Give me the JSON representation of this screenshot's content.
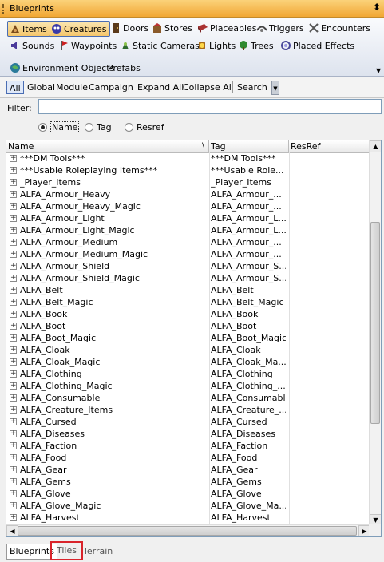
{
  "panel": {
    "title": "Blueprints",
    "pin_glyph": "⬍"
  },
  "toolbar": {
    "row1": [
      {
        "label": "Items",
        "icon": "items-icon",
        "active": true
      },
      {
        "label": "Creatures",
        "icon": "creatures-icon",
        "active": true
      },
      {
        "label": "Doors",
        "icon": "doors-icon"
      },
      {
        "label": "Stores",
        "icon": "stores-icon"
      },
      {
        "label": "Placeables",
        "icon": "placeables-icon"
      },
      {
        "label": "Triggers",
        "icon": "triggers-icon"
      },
      {
        "label": "Encounters",
        "icon": "encounters-icon"
      }
    ],
    "row2": [
      {
        "label": "Sounds",
        "icon": "sounds-icon"
      },
      {
        "label": "Waypoints",
        "icon": "waypoints-icon"
      },
      {
        "label": "Static Cameras",
        "icon": "cameras-icon"
      },
      {
        "label": "Lights",
        "icon": "lights-icon"
      },
      {
        "label": "Trees",
        "icon": "trees-icon"
      },
      {
        "label": "Placed Effects",
        "icon": "effects-icon"
      }
    ],
    "row3": [
      {
        "label": "Environment Objects",
        "icon": "environment-icon"
      },
      {
        "label": "Prefabs"
      }
    ]
  },
  "filter_bar": {
    "buttons": [
      "All",
      "Global",
      "Module",
      "Campaign",
      "Expand All",
      "Collapse All",
      "Search"
    ]
  },
  "filter": {
    "label": "Filter:",
    "value": ""
  },
  "search_by": {
    "options": [
      "Name",
      "Tag",
      "Resref"
    ],
    "selected": "Name"
  },
  "tree": {
    "columns": [
      "Name",
      "Tag",
      "ResRef"
    ],
    "rows": [
      {
        "name": "***DM Tools***",
        "tag": "***DM Tools***"
      },
      {
        "name": "***Usable Roleplaying Items***",
        "tag": "***Usable Role..."
      },
      {
        "name": "_Player_Items",
        "tag": "_Player_Items"
      },
      {
        "name": "ALFA_Armour_Heavy",
        "tag": "ALFA_Armour_..."
      },
      {
        "name": "ALFA_Armour_Heavy_Magic",
        "tag": "ALFA_Armour_..."
      },
      {
        "name": "ALFA_Armour_Light",
        "tag": "ALFA_Armour_L..."
      },
      {
        "name": "ALFA_Armour_Light_Magic",
        "tag": "ALFA_Armour_L..."
      },
      {
        "name": "ALFA_Armour_Medium",
        "tag": "ALFA_Armour_..."
      },
      {
        "name": "ALFA_Armour_Medium_Magic",
        "tag": "ALFA_Armour_..."
      },
      {
        "name": "ALFA_Armour_Shield",
        "tag": "ALFA_Armour_S..."
      },
      {
        "name": "ALFA_Armour_Shield_Magic",
        "tag": "ALFA_Armour_S..."
      },
      {
        "name": "ALFA_Belt",
        "tag": "ALFA_Belt"
      },
      {
        "name": "ALFA_Belt_Magic",
        "tag": "ALFA_Belt_Magic"
      },
      {
        "name": "ALFA_Book",
        "tag": "ALFA_Book"
      },
      {
        "name": "ALFA_Boot",
        "tag": "ALFA_Boot"
      },
      {
        "name": "ALFA_Boot_Magic",
        "tag": "ALFA_Boot_Magic"
      },
      {
        "name": "ALFA_Cloak",
        "tag": "ALFA_Cloak"
      },
      {
        "name": "ALFA_Cloak_Magic",
        "tag": "ALFA_Cloak_Ma..."
      },
      {
        "name": "ALFA_Clothing",
        "tag": "ALFA_Clothing"
      },
      {
        "name": "ALFA_Clothing_Magic",
        "tag": "ALFA_Clothing_..."
      },
      {
        "name": "ALFA_Consumable",
        "tag": "ALFA_Consumable"
      },
      {
        "name": "ALFA_Creature_Items",
        "tag": "ALFA_Creature_..."
      },
      {
        "name": "ALFA_Cursed",
        "tag": "ALFA_Cursed"
      },
      {
        "name": "ALFA_Diseases",
        "tag": "ALFA_Diseases"
      },
      {
        "name": "ALFA_Faction",
        "tag": "ALFA_Faction"
      },
      {
        "name": "ALFA_Food",
        "tag": "ALFA_Food"
      },
      {
        "name": "ALFA_Gear",
        "tag": "ALFA_Gear"
      },
      {
        "name": "ALFA_Gems",
        "tag": "ALFA_Gems"
      },
      {
        "name": "ALFA_Glove",
        "tag": "ALFA_Glove"
      },
      {
        "name": "ALFA_Glove_Magic",
        "tag": "ALFA_Glove_Ma..."
      },
      {
        "name": "ALFA_Harvest",
        "tag": "ALFA_Harvest"
      }
    ]
  },
  "bottom_tabs": [
    {
      "label": "Blueprints",
      "active": true
    },
    {
      "label": "Tiles",
      "highlighted": true
    },
    {
      "label": "Terrain"
    }
  ],
  "colors": {
    "accent": "#f1a734",
    "highlight_box": "#d9242b"
  }
}
